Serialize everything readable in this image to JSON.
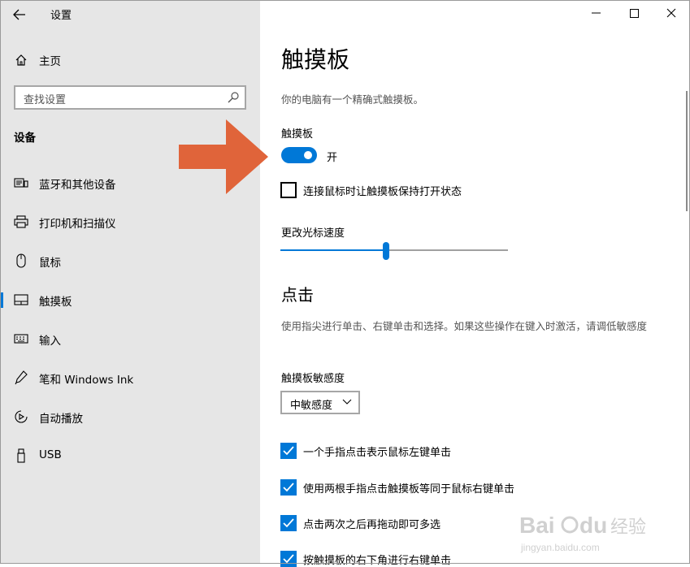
{
  "window": {
    "title": "设置"
  },
  "sidebar": {
    "home_label": "主页",
    "search_placeholder": "查找设置",
    "section_title": "设备",
    "items": [
      {
        "label": "蓝牙和其他设备",
        "icon": "bluetooth-devices-icon"
      },
      {
        "label": "打印机和扫描仪",
        "icon": "printer-icon"
      },
      {
        "label": "鼠标",
        "icon": "mouse-icon"
      },
      {
        "label": "触摸板",
        "icon": "touchpad-icon",
        "active": true
      },
      {
        "label": "输入",
        "icon": "keyboard-icon"
      },
      {
        "label": "笔和 Windows Ink",
        "icon": "pen-icon"
      },
      {
        "label": "自动播放",
        "icon": "autoplay-icon"
      },
      {
        "label": "USB",
        "icon": "usb-icon"
      }
    ]
  },
  "main": {
    "title": "触摸板",
    "description": "你的电脑有一个精确式触摸板。",
    "touchpad_label": "触摸板",
    "toggle_state": "开",
    "toggle_on": true,
    "keep_on_with_mouse": {
      "label": "连接鼠标时让触摸板保持打开状态",
      "checked": false
    },
    "cursor_speed_label": "更改光标速度",
    "cursor_speed_fraction": 0.45,
    "taps_title": "点击",
    "taps_description": "使用指尖进行单击、右键单击和选择。如果这些操作在键入时激活，请调低敏感度",
    "sensitivity_label": "触摸板敏感度",
    "sensitivity_value": "中敏感度",
    "options": [
      {
        "label": "一个手指点击表示鼠标左键单击",
        "checked": true
      },
      {
        "label": "使用两根手指点击触摸板等同于鼠标右键单击",
        "checked": true
      },
      {
        "label": "点击两次之后再拖动即可多选",
        "checked": true
      },
      {
        "label": "按触摸板的右下角进行右键单击",
        "checked": true
      }
    ]
  },
  "colors": {
    "accent": "#0078d7",
    "sidebar_bg": "#e6e6e6",
    "arrow": "#e0643a"
  },
  "watermark": {
    "brand": "Baidu",
    "cn": "经验",
    "url": "jingyan.baidu.com"
  }
}
